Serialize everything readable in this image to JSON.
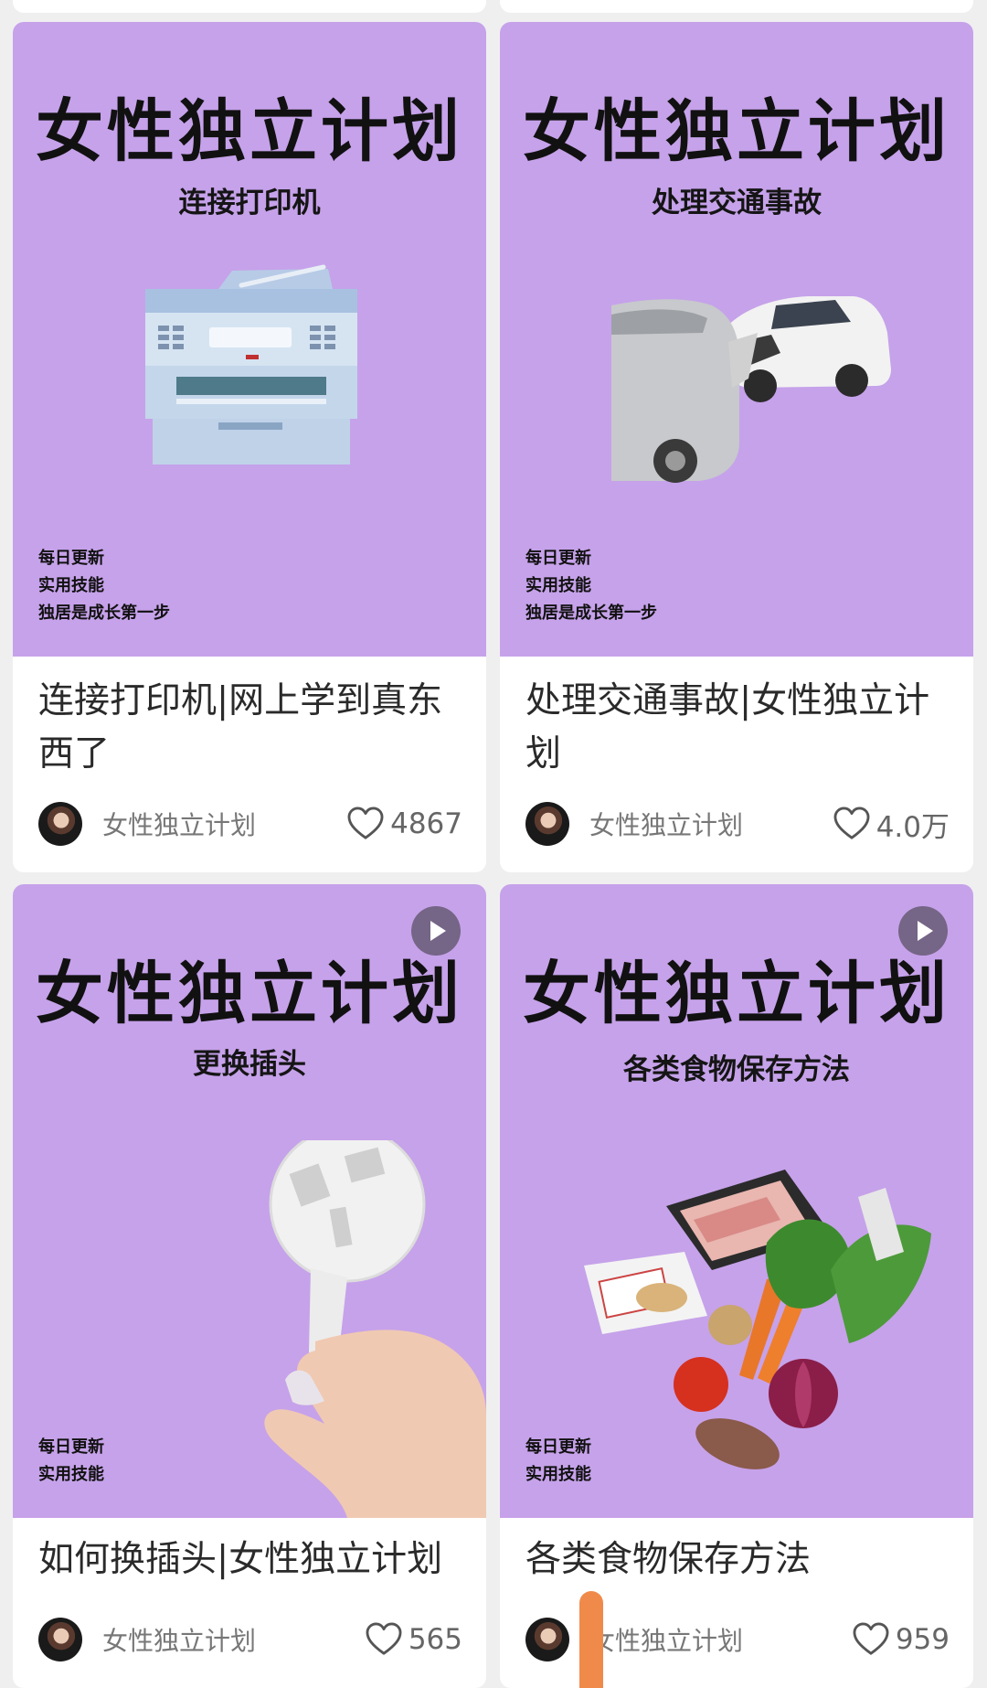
{
  "cards": [
    {
      "cover_title": "女性独立计划",
      "cover_subtitle": "连接打印机",
      "tags": [
        "每日更新",
        "实用技能",
        "独居是成长第一步"
      ],
      "image_icon": "printer-icon",
      "has_play": false,
      "title": "连接打印机|网上学到真东西了",
      "author": "女性独立计划",
      "likes": "4867"
    },
    {
      "cover_title": "女性独立计划",
      "cover_subtitle": "处理交通事故",
      "tags": [
        "每日更新",
        "实用技能",
        "独居是成长第一步"
      ],
      "image_icon": "car-crash-icon",
      "has_play": false,
      "title": "处理交通事故|女性独立计划",
      "author": "女性独立计划",
      "likes": "4.0万"
    },
    {
      "cover_title": "女性独立计划",
      "cover_subtitle": "更换插头",
      "tags": [
        "每日更新",
        "实用技能"
      ],
      "image_icon": "plug-icon",
      "has_play": true,
      "title": "如何换插头|女性独立计划",
      "author": "女性独立计划",
      "likes": "565"
    },
    {
      "cover_title": "女性独立计划",
      "cover_subtitle": "各类食物保存方法",
      "tags": [
        "每日更新",
        "实用技能"
      ],
      "image_icon": "groceries-icon",
      "has_play": true,
      "title": "各类食物保存方法",
      "author": "女性独立计划",
      "likes": "959"
    }
  ],
  "colors": {
    "cover_bg": "#c6a2ea",
    "card_bg": "#ffffff",
    "page_bg": "#efefef"
  }
}
